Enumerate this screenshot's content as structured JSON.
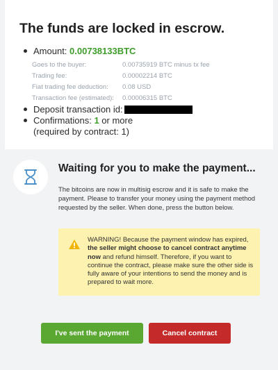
{
  "escrow": {
    "title": "The funds are locked in escrow.",
    "amount_label": "Amount:",
    "amount_value": "0.00738133BTC",
    "details": [
      {
        "label": "Goes to the buyer:",
        "value": "0.00735919 BTC minus tx fee"
      },
      {
        "label": "Trading fee:",
        "value": "0.00002214 BTC"
      },
      {
        "label": "Fiat trading fee deduction:",
        "value": "0.08 USD"
      },
      {
        "label": "Transaction fee (estimated):",
        "value": "0.00006315 BTC"
      }
    ],
    "deposit_label": "Deposit transaction id:",
    "confirmations_label": "Confirmations:",
    "confirmations_value": "1",
    "confirmations_suffix": "or more",
    "required_text": "(required by contract: 1)"
  },
  "waiting": {
    "title": "Waiting for you to make the payment...",
    "body": "The bitcoins are now in multisig escrow and it is safe to make the payment. Please to transfer your money using the payment method requested by the seller. When done, press the button below.",
    "warning_prefix": "WARNING! Because the payment window has expired,",
    "warning_bold": "the seller might choose to cancel contract anytime now",
    "warning_suffix": "and refund himself. Therefore, if you want to continue the contract, please make sure the other side is fully aware of your intentions to send the money and is prepared to wait more."
  },
  "buttons": {
    "sent_label": "I've sent the payment",
    "cancel_label": "Cancel contract"
  },
  "colors": {
    "accent_green": "#3e9d2a",
    "button_green": "#5aa832",
    "button_red": "#c42a2a",
    "warning_bg": "#fdf2b0",
    "icon_blue": "#4a90c8",
    "warning_icon": "#f0b400"
  }
}
